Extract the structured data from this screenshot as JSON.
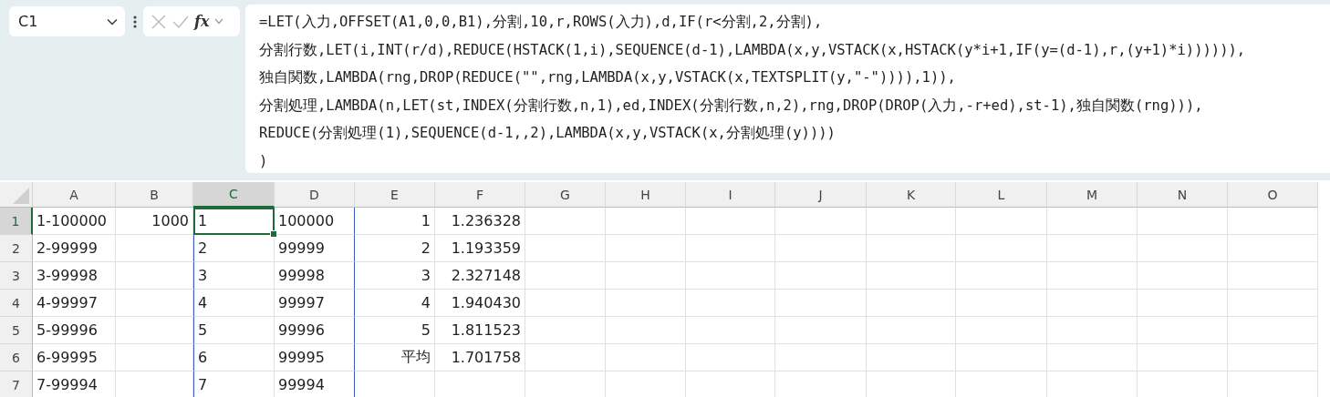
{
  "name_box": {
    "value": "C1"
  },
  "formula_buttons": {
    "function_label": "fx"
  },
  "formula_bar": {
    "lines": [
      "=LET(入力,OFFSET(A1,0,0,B1),分割,10,r,ROWS(入力),d,IF(r<分割,2,分割),",
      "分割行数,LET(i,INT(r/d),REDUCE(HSTACK(1,i),SEQUENCE(d-1),LAMBDA(x,y,VSTACK(x,HSTACK(y*i+1,IF(y=(d-1),r,(y+1)*i)))))),",
      "独自関数,LAMBDA(rng,DROP(REDUCE(\"\",rng,LAMBDA(x,y,VSTACK(x,TEXTSPLIT(y,\"-\")))),1)),",
      "分割処理,LAMBDA(n,LET(st,INDEX(分割行数,n,1),ed,INDEX(分割行数,n,2),rng,DROP(DROP(入力,-r+ed),st-1),独自関数(rng))),",
      "REDUCE(分割処理(1),SEQUENCE(d-1,,2),LAMBDA(x,y,VSTACK(x,分割処理(y))))",
      ")"
    ]
  },
  "columns": [
    {
      "label": "A",
      "selected": false
    },
    {
      "label": "B",
      "selected": false
    },
    {
      "label": "C",
      "selected": true
    },
    {
      "label": "D",
      "selected": false
    },
    {
      "label": "E",
      "selected": false
    },
    {
      "label": "F",
      "selected": false
    },
    {
      "label": "G",
      "selected": false
    },
    {
      "label": "H",
      "selected": false
    },
    {
      "label": "I",
      "selected": false
    },
    {
      "label": "J",
      "selected": false
    },
    {
      "label": "K",
      "selected": false
    },
    {
      "label": "L",
      "selected": false
    },
    {
      "label": "M",
      "selected": false
    },
    {
      "label": "N",
      "selected": false
    },
    {
      "label": "O",
      "selected": false
    }
  ],
  "rows": [
    {
      "header": "1",
      "selected": true,
      "cells": [
        {
          "text": "1-100000",
          "kind": "text"
        },
        {
          "text": "1000",
          "kind": "number"
        },
        {
          "text": "1",
          "kind": "text",
          "spill_left": true,
          "selected": true
        },
        {
          "text": "100000",
          "kind": "text",
          "spill_right": true
        },
        {
          "text": "1",
          "kind": "number"
        },
        {
          "text": "1.236328",
          "kind": "number"
        }
      ]
    },
    {
      "header": "2",
      "selected": false,
      "cells": [
        {
          "text": "2-99999",
          "kind": "text"
        },
        null,
        {
          "text": "2",
          "kind": "text",
          "spill_left": true
        },
        {
          "text": "99999",
          "kind": "text",
          "spill_right": true
        },
        {
          "text": "2",
          "kind": "number"
        },
        {
          "text": "1.193359",
          "kind": "number"
        }
      ]
    },
    {
      "header": "3",
      "selected": false,
      "cells": [
        {
          "text": "3-99998",
          "kind": "text"
        },
        null,
        {
          "text": "3",
          "kind": "text",
          "spill_left": true
        },
        {
          "text": "99998",
          "kind": "text",
          "spill_right": true
        },
        {
          "text": "3",
          "kind": "number"
        },
        {
          "text": "2.327148",
          "kind": "number"
        }
      ]
    },
    {
      "header": "4",
      "selected": false,
      "cells": [
        {
          "text": "4-99997",
          "kind": "text"
        },
        null,
        {
          "text": "4",
          "kind": "text",
          "spill_left": true
        },
        {
          "text": "99997",
          "kind": "text",
          "spill_right": true
        },
        {
          "text": "4",
          "kind": "number"
        },
        {
          "text": "1.940430",
          "kind": "number"
        }
      ]
    },
    {
      "header": "5",
      "selected": false,
      "cells": [
        {
          "text": "5-99996",
          "kind": "text"
        },
        null,
        {
          "text": "5",
          "kind": "text",
          "spill_left": true
        },
        {
          "text": "99996",
          "kind": "text",
          "spill_right": true
        },
        {
          "text": "5",
          "kind": "number"
        },
        {
          "text": "1.811523",
          "kind": "number"
        }
      ]
    },
    {
      "header": "6",
      "selected": false,
      "cells": [
        {
          "text": "6-99995",
          "kind": "text"
        },
        null,
        {
          "text": "6",
          "kind": "text",
          "spill_left": true
        },
        {
          "text": "99995",
          "kind": "text",
          "spill_right": true
        },
        {
          "text": "平均",
          "kind": "number"
        },
        {
          "text": "1.701758",
          "kind": "number"
        }
      ]
    },
    {
      "header": "7",
      "selected": false,
      "cells": [
        {
          "text": "7-99994",
          "kind": "text"
        },
        null,
        {
          "text": "7",
          "kind": "text",
          "spill_left": true
        },
        {
          "text": "99994",
          "kind": "text",
          "spill_right": true
        },
        null,
        null
      ]
    }
  ]
}
